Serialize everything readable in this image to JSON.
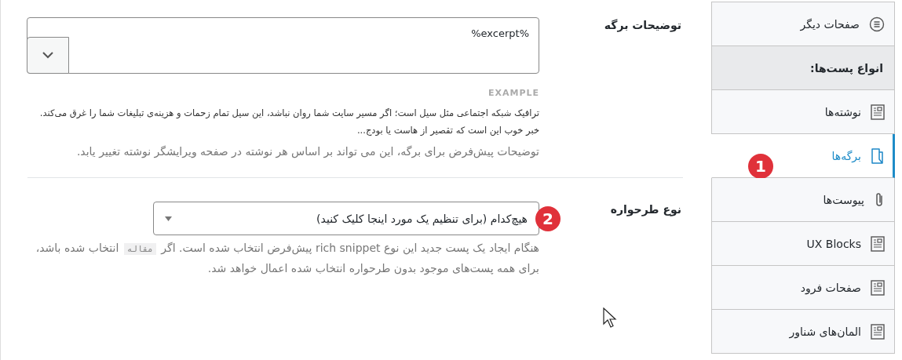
{
  "fields": [
    {
      "kind": "textarea",
      "label": "توضیحات برگه",
      "value": "%excerpt%",
      "example": {
        "heading": "EXAMPLE",
        "text": "ترافیک شبکه اجتماعی مثل سیل است؛ اگر مسیر سایت شما روان نباشد، این سیل تمام زحمات و هزینه‌ی تبلیغات شما را غرق می‌کند. خبر خوب این است که تقصیر از هاست یا بودج..."
      },
      "description": [
        {
          "kind": "text",
          "text": "توضیحات پیش‌فرض برای برگه، این می تواند بر اساس هر نوشته در صفحه ویرایشگر نوشته تغییر یابد."
        }
      ]
    },
    {
      "kind": "select",
      "label": "نوع طرحواره",
      "value": "هیچ‌کدام (برای تنظیم یک مورد اینجا کلیک کنید)",
      "badge": "2",
      "description": [
        {
          "kind": "text",
          "text": "هنگام ایجاد یک پست جدید این نوع rich snippet پیش‌فرض انتخاب شده است. اگر "
        },
        {
          "kind": "code",
          "text": "مقاله"
        },
        {
          "kind": "text",
          "text": " انتخاب شده باشد، برای همه پست‌های موجود بدون طرحواره انتخاب شده اعمال خواهد شد."
        }
      ]
    }
  ],
  "sidebar": {
    "items": [
      {
        "kind": "menu",
        "label": "صفحات دیگر",
        "selected": false
      },
      {
        "kind": "heading",
        "label": "انواع پست‌ها:"
      },
      {
        "kind": "document",
        "label": "نوشته‌ها",
        "selected": false
      },
      {
        "kind": "page",
        "label": "برگه‌ها",
        "selected": true,
        "badge": "1"
      },
      {
        "kind": "attachment",
        "label": "پیوست‌ها",
        "selected": false
      },
      {
        "kind": "document",
        "label": "UX Blocks",
        "selected": false
      },
      {
        "kind": "document",
        "label": "صفحات فرود",
        "selected": false
      },
      {
        "kind": "document",
        "label": "المان‌های شناور",
        "selected": false
      }
    ]
  }
}
